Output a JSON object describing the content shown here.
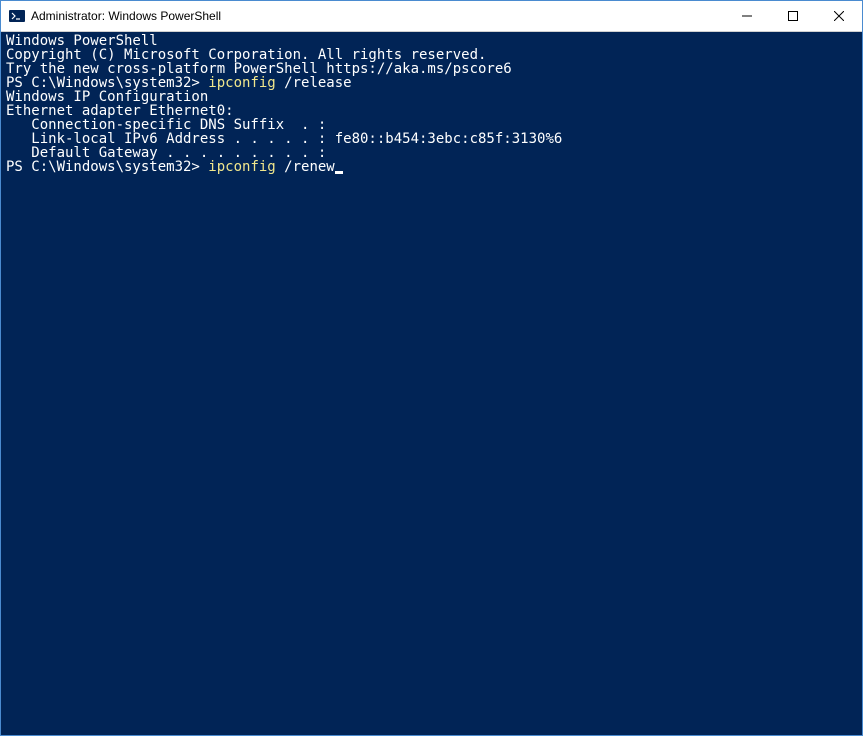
{
  "window": {
    "title": "Administrator: Windows PowerShell"
  },
  "terminal": {
    "lines": [
      {
        "segments": [
          {
            "text": "Windows PowerShell"
          }
        ]
      },
      {
        "segments": [
          {
            "text": "Copyright (C) Microsoft Corporation. All rights reserved."
          }
        ]
      },
      {
        "segments": [
          {
            "text": ""
          }
        ]
      },
      {
        "segments": [
          {
            "text": "Try the new cross-platform PowerShell https://aka.ms/pscore6"
          }
        ]
      },
      {
        "segments": [
          {
            "text": ""
          }
        ]
      },
      {
        "segments": [
          {
            "text": "PS C:\\Windows\\system32> "
          },
          {
            "text": "ipconfig ",
            "class": "cmd-yellow"
          },
          {
            "text": "/release"
          }
        ]
      },
      {
        "segments": [
          {
            "text": ""
          }
        ]
      },
      {
        "segments": [
          {
            "text": "Windows IP Configuration"
          }
        ]
      },
      {
        "segments": [
          {
            "text": ""
          }
        ]
      },
      {
        "segments": [
          {
            "text": ""
          }
        ]
      },
      {
        "segments": [
          {
            "text": "Ethernet adapter Ethernet0:"
          }
        ]
      },
      {
        "segments": [
          {
            "text": ""
          }
        ]
      },
      {
        "segments": [
          {
            "text": "   Connection-specific DNS Suffix  . :"
          }
        ]
      },
      {
        "segments": [
          {
            "text": "   Link-local IPv6 Address . . . . . : fe80::b454:3ebc:c85f:3130%6"
          }
        ]
      },
      {
        "segments": [
          {
            "text": "   Default Gateway . . . . . . . . . :"
          }
        ]
      },
      {
        "segments": [
          {
            "text": "PS C:\\Windows\\system32> "
          },
          {
            "text": "ipconfig ",
            "class": "cmd-yellow"
          },
          {
            "text": "/renew"
          }
        ],
        "cursor": true
      }
    ]
  }
}
